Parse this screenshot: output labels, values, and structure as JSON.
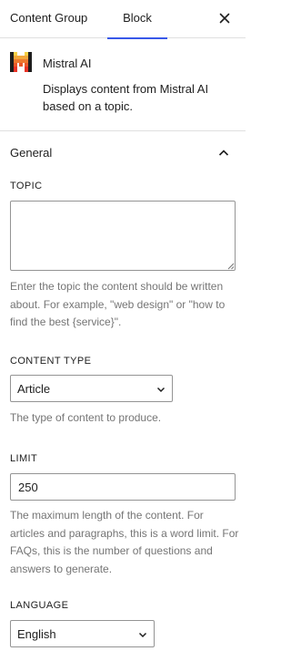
{
  "tabs": {
    "content_group": "Content Group",
    "block": "Block",
    "active": "Block",
    "accent_color": "#3858e9"
  },
  "close_icon": "close-icon",
  "block": {
    "title": "Mistral AI",
    "description": "Displays content from Mistral AI based on a topic.",
    "icon": "mistral-logo"
  },
  "panel": {
    "title": "General",
    "expanded": true
  },
  "topic": {
    "label": "TOPIC",
    "value": "",
    "help": "Enter the topic the content should be written about. For example, \"web design\" or \"how to find the best {service}\"."
  },
  "content_type": {
    "label": "CONTENT TYPE",
    "value": "Article",
    "help": "The type of content to produce."
  },
  "limit": {
    "label": "LIMIT",
    "value": "250",
    "help": "The maximum length of the content. For articles and paragraphs, this is a word limit. For FAQs, this is the number of questions and answers to generate."
  },
  "language": {
    "label": "LANGUAGE",
    "value": "English"
  }
}
